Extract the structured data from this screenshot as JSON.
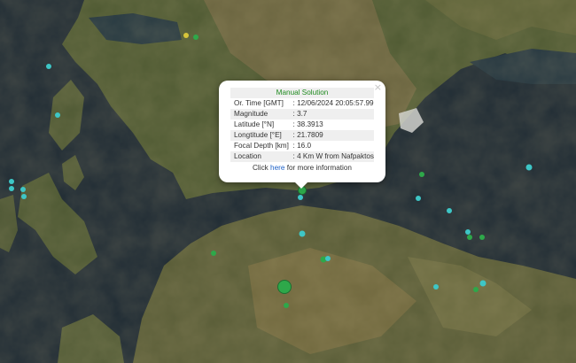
{
  "popup": {
    "close_glyph": "×",
    "title": "Manual Solution",
    "rows": [
      {
        "label": "Or. Time [GMT]",
        "value": ": 12/06/2024 20:05:57.99"
      },
      {
        "label": "Magnitude",
        "value": ": 3.7"
      },
      {
        "label": "Latitude [°N]",
        "value": ": 38.3913"
      },
      {
        "label": "Longtitude [°E]",
        "value": ": 21.7809"
      },
      {
        "label": "Focal Depth [km]",
        "value": ": 16.0"
      },
      {
        "label": "Location",
        "value": ": 4 Km W from Nafpaktos"
      }
    ],
    "more_prefix": "Click",
    "more_link": "here",
    "more_suffix": "for more information"
  },
  "colors": {
    "cyan_event": "#3ec6c6",
    "green_event": "#2ea84a",
    "yellow_event": "#d6c53a",
    "title_green": "#1f8a1f",
    "link_blue": "#1a5fc7"
  },
  "map": {
    "event_markers_count_note": "earthquake epicenters"
  }
}
